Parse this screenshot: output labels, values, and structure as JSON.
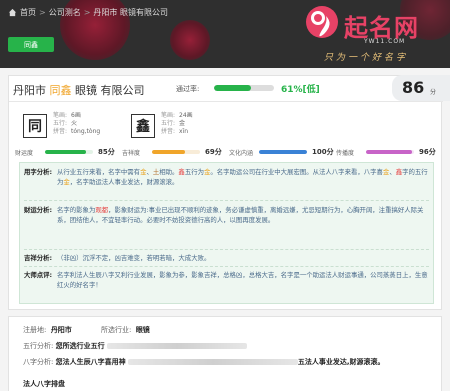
{
  "breadcrumb": {
    "home": "首页",
    "sep": ">",
    "section": "公司测名",
    "current": "丹阳市 眼镜有限公司"
  },
  "top_button": "同鑫",
  "logo": {
    "name": "起名网",
    "url": "YW11.COM",
    "slogan": "只为一个好名字"
  },
  "header": {
    "title_prefix": "丹阳市 ",
    "title_highlight": "同鑫",
    "title_suffix": " 眼镜 有限公司",
    "pass_label": "通过率:",
    "pass_rate": 0.61,
    "pass_text": "61%[低]",
    "score": "86",
    "score_unit": "分"
  },
  "chars": [
    {
      "char": "同",
      "strokes_label": "笔画:",
      "strokes": "6画",
      "element_label": "五行:",
      "element": "火",
      "pinyin_label": "拼音:",
      "pinyin": "tóng,tòng"
    },
    {
      "char": "鑫",
      "strokes_label": "笔画:",
      "strokes": "24画",
      "element_label": "五行:",
      "element": "金",
      "pinyin_label": "拼音:",
      "pinyin": "xīn"
    }
  ],
  "metrics": [
    {
      "label": "财运度",
      "value": 85,
      "text": "85分",
      "color": "#27b34a"
    },
    {
      "label": "吉祥度",
      "value": 69,
      "text": "69分",
      "color": "#f0a52a"
    },
    {
      "label": "文化内涵",
      "value": 100,
      "text": "100分",
      "color": "#3a82d6"
    },
    {
      "label": "传播度",
      "value": 96,
      "text": "96分",
      "color": "#c864c8"
    }
  ],
  "analysis": {
    "usage": {
      "key": "用字分析:",
      "parts": [
        [
          "t",
          "从行业五行来看，名字中需有"
        ],
        [
          "y",
          "金"
        ],
        [
          "t",
          "、"
        ],
        [
          "br",
          "土"
        ],
        [
          "t",
          "相助。"
        ],
        [
          "r",
          "鑫"
        ],
        [
          "t",
          "五行为"
        ],
        [
          "y",
          "金"
        ],
        [
          "t",
          "。名字助运公司在行业中大展宏图。从法人八字来看，八字喜"
        ],
        [
          "y",
          "金"
        ],
        [
          "t",
          "、"
        ],
        [
          "r",
          "鑫"
        ],
        [
          "t",
          "字的五行为"
        ],
        [
          "y",
          "金"
        ],
        [
          "t",
          "，名字助运法人事业发达，财源滚滚。"
        ]
      ]
    },
    "fortune": {
      "key": "财运分析:",
      "parts": [
        [
          "t",
          "名字的影象为"
        ],
        [
          "r",
          "观都"
        ],
        [
          "t",
          "，影象财运为:事业已出现不顺利的迹象，务必谦虚慎重，离婚远嫌，尤忌短期行为，心胸开阔，注重搞好人际关系，团结他人，不宜轻率行动。必要时不妨投资德行高的人，以图再度发展。"
        ]
      ]
    },
    "lucky": {
      "key": "吉祥分析:",
      "parts": [
        [
          "t",
          "（非凶）沉浮不定，凶吉难变，若明若暗，大成大败。"
        ]
      ]
    },
    "master": {
      "key": "大师点评:",
      "parts": [
        [
          "t",
          "名字利法人生辰八字又利行业发展，影象为参，影象吉祥，总格凶，总格大吉，名字是一个助运法人财运事通，公司蒸蒸日上，生意红火的好名字！"
        ]
      ]
    }
  },
  "info": {
    "location_label": "注册地:",
    "location": "丹阳市",
    "industry_label": "所选行业:",
    "industry": "眼镜",
    "element_label": "五行分析:",
    "element_text": "您所选行业五行",
    "bazi_label": "八字分析:",
    "bazi_text": "您法人生辰八字喜用神",
    "bazi_tail": "五法人事业发达,财源滚滚。",
    "sub_heading": "法人八字排盘"
  }
}
